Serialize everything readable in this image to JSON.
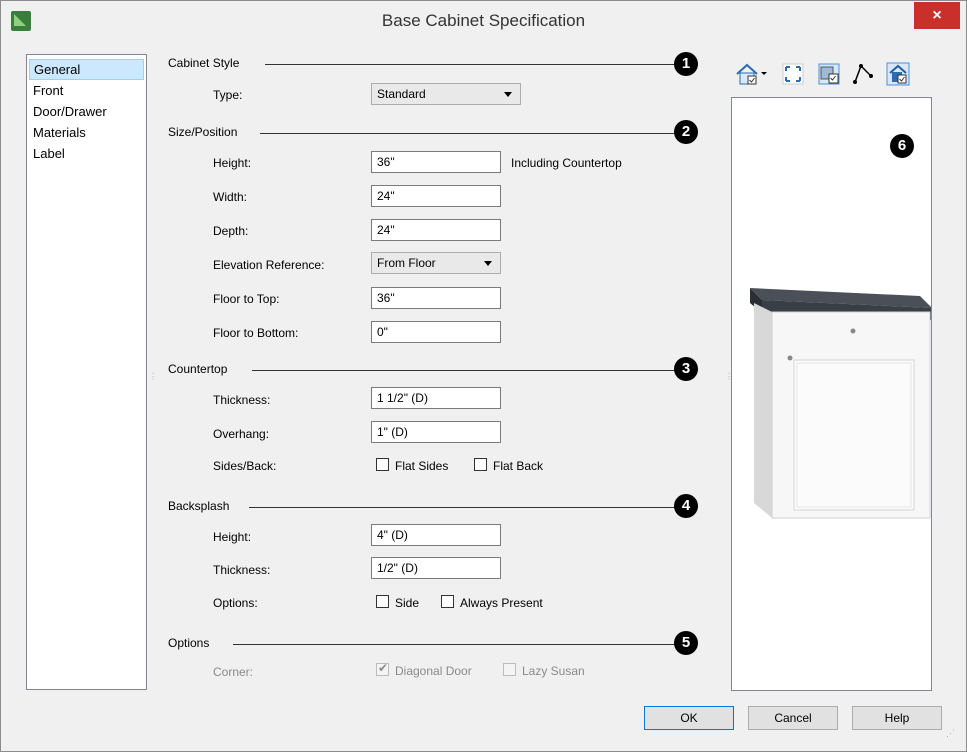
{
  "window": {
    "title": "Base Cabinet Specification",
    "close_label": "×"
  },
  "nav": {
    "items": [
      "General",
      "Front",
      "Door/Drawer",
      "Materials",
      "Label"
    ],
    "selected": "General"
  },
  "sections": {
    "cabinet_style": {
      "title": "Cabinet Style",
      "badge": "1",
      "type_label": "Type:",
      "type_value": "Standard"
    },
    "size_position": {
      "title": "Size/Position",
      "badge": "2",
      "height_label": "Height:",
      "height_value": "36\"",
      "height_note": "Including Countertop",
      "width_label": "Width:",
      "width_value": "24\"",
      "depth_label": "Depth:",
      "depth_value": "24\"",
      "elev_label": "Elevation Reference:",
      "elev_value": "From Floor",
      "floor_top_label": "Floor to Top:",
      "floor_top_value": "36\"",
      "floor_bottom_label": "Floor to Bottom:",
      "floor_bottom_value": "0\""
    },
    "countertop": {
      "title": "Countertop",
      "badge": "3",
      "thickness_label": "Thickness:",
      "thickness_value": "1 1/2\" (D)",
      "overhang_label": "Overhang:",
      "overhang_value": "1\" (D)",
      "sides_label": "Sides/Back:",
      "flat_sides": "Flat Sides",
      "flat_back": "Flat Back"
    },
    "backsplash": {
      "title": "Backsplash",
      "badge": "4",
      "height_label": "Height:",
      "height_value": "4\" (D)",
      "thickness_label": "Thickness:",
      "thickness_value": "1/2\" (D)",
      "options_label": "Options:",
      "side": "Side",
      "always_present": "Always Present"
    },
    "options": {
      "title": "Options",
      "badge": "5",
      "corner_label": "Corner:",
      "diagonal_door": "Diagonal Door",
      "lazy_susan": "Lazy Susan"
    }
  },
  "preview": {
    "badge": "6"
  },
  "buttons": {
    "ok": "OK",
    "cancel": "Cancel",
    "help": "Help"
  },
  "colors": {
    "accent": "#0078d7",
    "close": "#c9302c",
    "countertop": "#3a3f47"
  }
}
